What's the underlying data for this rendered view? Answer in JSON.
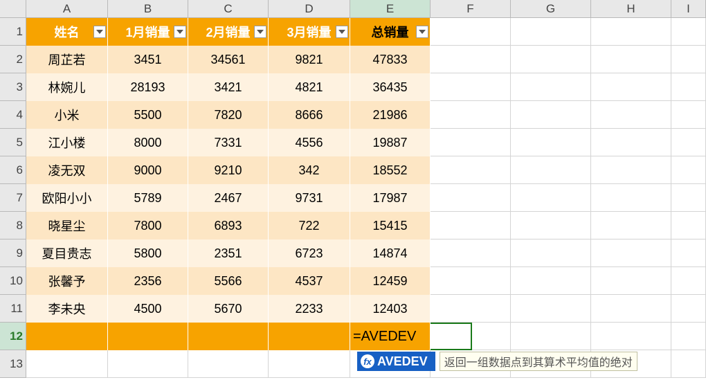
{
  "columns": [
    "A",
    "B",
    "C",
    "D",
    "E",
    "F",
    "G",
    "H",
    "I"
  ],
  "rows_visible": 13,
  "selected_cell": "E12",
  "headers": {
    "A": "姓名",
    "B": "1月销量",
    "C": "2月销量",
    "D": "3月销量",
    "E": "总销量"
  },
  "data_rows": [
    {
      "name": "周芷若",
      "m1": 3451,
      "m2": 34561,
      "m3": 9821,
      "total": 47833
    },
    {
      "name": "林婉儿",
      "m1": 28193,
      "m2": 3421,
      "m3": 4821,
      "total": 36435
    },
    {
      "name": "小米",
      "m1": 5500,
      "m2": 7820,
      "m3": 8666,
      "total": 21986
    },
    {
      "name": "江小楼",
      "m1": 8000,
      "m2": 7331,
      "m3": 4556,
      "total": 19887
    },
    {
      "name": "凌无双",
      "m1": 9000,
      "m2": 9210,
      "m3": 342,
      "total": 18552
    },
    {
      "name": "欧阳小小",
      "m1": 5789,
      "m2": 2467,
      "m3": 9731,
      "total": 17987
    },
    {
      "name": "晓星尘",
      "m1": 7800,
      "m2": 6893,
      "m3": 722,
      "total": 15415
    },
    {
      "name": "夏目贵志",
      "m1": 5800,
      "m2": 2351,
      "m3": 6723,
      "total": 14874
    },
    {
      "name": "张馨予",
      "m1": 2356,
      "m2": 5566,
      "m3": 4537,
      "total": 12459
    },
    {
      "name": "李未央",
      "m1": 4500,
      "m2": 5670,
      "m3": 2233,
      "total": 12403
    }
  ],
  "editing": {
    "row": 12,
    "col": "E",
    "formula_text": "=AVEDEV"
  },
  "suggestion": {
    "fx_label": "fx",
    "name": "AVEDEV",
    "description": "返回一组数据点到其算术平均值的绝对"
  }
}
